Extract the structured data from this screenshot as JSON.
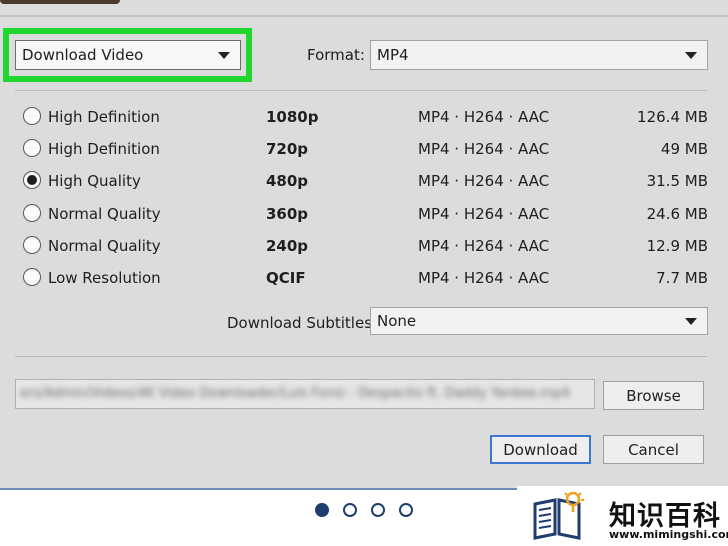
{
  "download_type": {
    "selected": "Download Video"
  },
  "format": {
    "label": "Format:",
    "selected": "MP4"
  },
  "options": [
    {
      "quality": "High Definition",
      "resolution": "1080p",
      "codec": "MP4 · H264 · AAC",
      "size": "126.4 MB",
      "selected": false
    },
    {
      "quality": "High Definition",
      "resolution": "720p",
      "codec": "MP4 · H264 · AAC",
      "size": "49 MB",
      "selected": false
    },
    {
      "quality": "High Quality",
      "resolution": "480p",
      "codec": "MP4 · H264 · AAC",
      "size": "31.5 MB",
      "selected": true
    },
    {
      "quality": "Normal Quality",
      "resolution": "360p",
      "codec": "MP4 · H264 · AAC",
      "size": "24.6 MB",
      "selected": false
    },
    {
      "quality": "Normal Quality",
      "resolution": "240p",
      "codec": "MP4 · H264 · AAC",
      "size": "12.9 MB",
      "selected": false
    },
    {
      "quality": "Low Resolution",
      "resolution": "QCIF",
      "codec": "MP4 · H264 · AAC",
      "size": "7.7 MB",
      "selected": false
    }
  ],
  "subtitles": {
    "label": "Download Subtitles:",
    "selected": "None"
  },
  "save_path": {
    "value": "ers/Admin/Videos/4K Video Downloader/Luis Fonsi - Despacito ft. Daddy Yankee.mp4"
  },
  "buttons": {
    "browse": "Browse",
    "download": "Download",
    "cancel": "Cancel"
  },
  "pagination": {
    "count": 4,
    "active_index": 0
  },
  "watermark": {
    "title": "知识百科",
    "url": "www.mimingshi.com"
  },
  "colors": {
    "highlight": "#22d630",
    "accent": "#3a78d4",
    "dot": "#1e3e6e"
  }
}
